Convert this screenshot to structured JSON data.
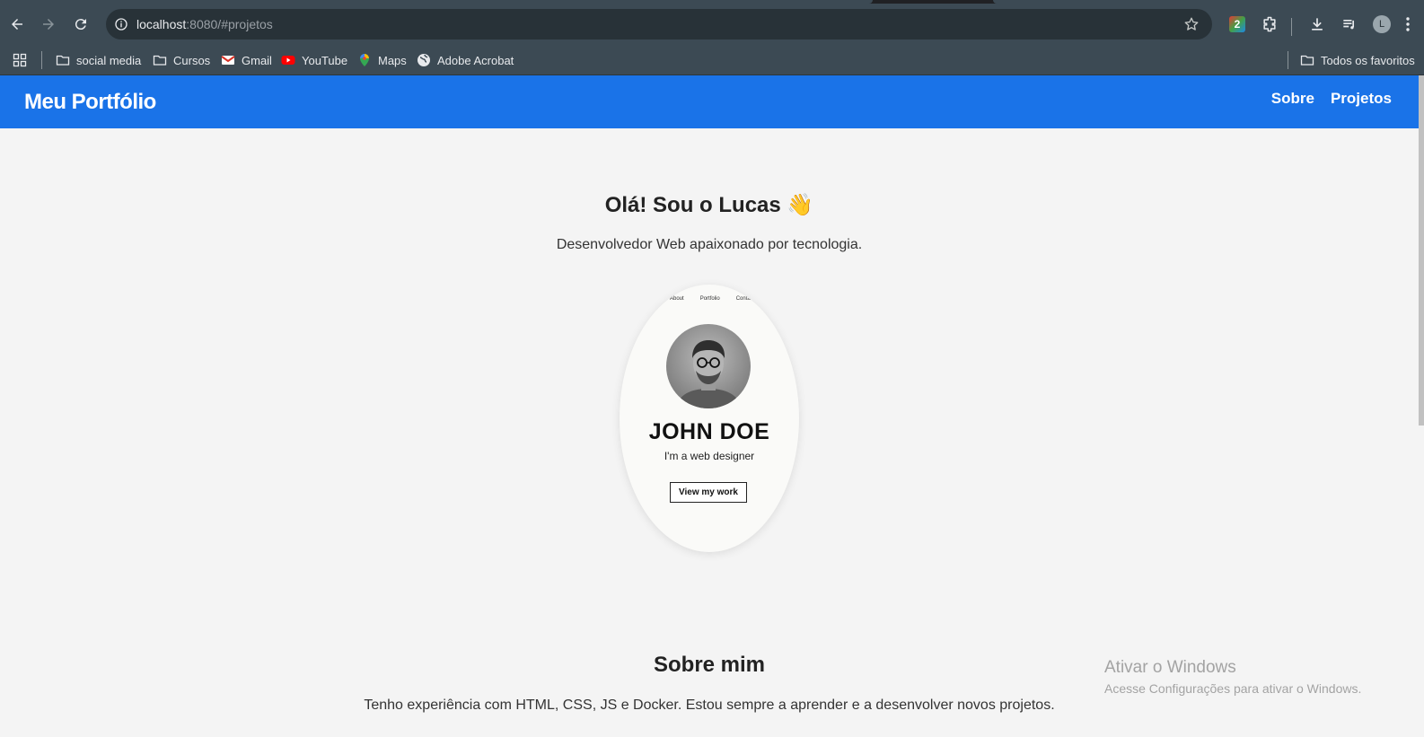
{
  "browser": {
    "url_host": "localhost",
    "url_rest": ":8080/#projetos",
    "bookmarks": [
      {
        "label": "social media",
        "icon": "folder-icon"
      },
      {
        "label": "Cursos",
        "icon": "folder-icon"
      },
      {
        "label": "Gmail",
        "icon": "gmail-icon"
      },
      {
        "label": "YouTube",
        "icon": "youtube-icon"
      },
      {
        "label": "Maps",
        "icon": "maps-icon"
      },
      {
        "label": "Adobe Acrobat",
        "icon": "globe-icon"
      }
    ],
    "all_bookmarks": "Todos os favoritos",
    "profile_initial": "L",
    "extension_badge": "2"
  },
  "site": {
    "brand": "Meu Portfólio",
    "nav": [
      "Sobre",
      "Projetos"
    ],
    "accent_color": "#1a73e8"
  },
  "hero": {
    "title": "Olá! Sou o Lucas 👋",
    "subtitle": "Desenvolvedor Web apaixonado por tecnologia."
  },
  "preview": {
    "nav": [
      "About",
      "Portfolio",
      "Contact"
    ],
    "name": "JOHN DOE",
    "role": "I'm a web designer",
    "cta": "View my work"
  },
  "about": {
    "title": "Sobre mim",
    "text": "Tenho experiência com HTML, CSS, JS e Docker. Estou sempre a aprender e a desenvolver novos projetos."
  },
  "watermark": {
    "title": "Ativar o Windows",
    "text": "Acesse Configurações para ativar o Windows."
  }
}
